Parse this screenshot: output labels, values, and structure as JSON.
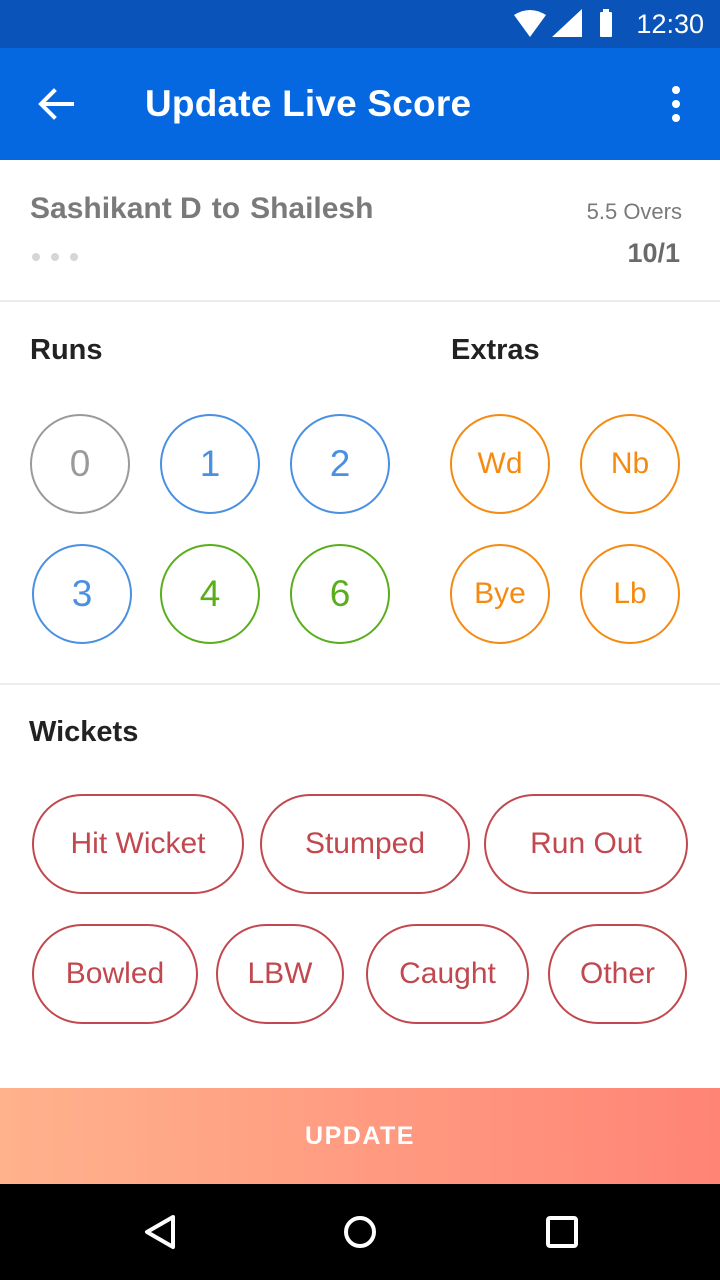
{
  "status_bar": {
    "time": "12:30"
  },
  "app_bar": {
    "title": "Update Live Score"
  },
  "match": {
    "bowler": "Sashikant D",
    "to_word": "to",
    "batsman": "Shailesh",
    "overs": "5.5 Overs",
    "score": "10/1"
  },
  "runs": {
    "heading": "Runs",
    "buttons": [
      "0",
      "1",
      "2",
      "3",
      "4",
      "6"
    ]
  },
  "extras": {
    "heading": "Extras",
    "buttons": [
      "Wd",
      "Nb",
      "Bye",
      "Lb"
    ]
  },
  "wickets": {
    "heading": "Wickets",
    "buttons": [
      "Hit Wicket",
      "Stumped",
      "Run Out",
      "Bowled",
      "LBW",
      "Caught",
      "Other"
    ]
  },
  "update_label": "UPDATE",
  "colors": {
    "status_bar": "#0a53b8",
    "app_bar": "#0668e1",
    "run_zero": "#9a9a9a",
    "run_single": "#4a90e2",
    "run_boundary": "#5aae1c",
    "extras": "#f58a12",
    "wickets": "#c0484e",
    "update_gradient_start": "#ffb28c",
    "update_gradient_end": "#ff8476"
  },
  "icons": {
    "status": [
      "wifi-icon",
      "signal-icon",
      "battery-icon"
    ],
    "app_bar": [
      "back-arrow-icon",
      "more-vert-icon"
    ],
    "nav": [
      "nav-back-icon",
      "nav-home-icon",
      "nav-recents-icon"
    ]
  }
}
